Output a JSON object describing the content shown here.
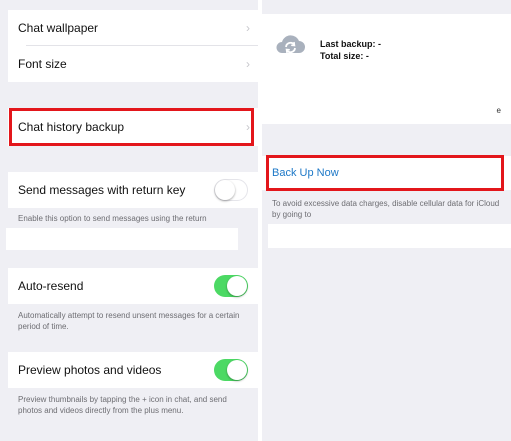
{
  "left": {
    "chat_wallpaper": "Chat wallpaper",
    "font_size": "Font size",
    "chat_history_backup": "Chat history backup",
    "send_with_return": {
      "label": "Send messages with return key",
      "desc": "Enable this option to send messages using the return",
      "enabled": false
    },
    "auto_resend": {
      "label": "Auto-resend",
      "desc": "Automatically attempt to resend unsent messages for a certain period of time.",
      "enabled": true
    },
    "preview_media": {
      "label": "Preview photos and videos",
      "desc": "Preview thumbnails by tapping the + icon in chat, and send photos and videos directly from the plus menu.",
      "enabled": true
    }
  },
  "right": {
    "last_backup": "Last backup: -",
    "total_size": "Total size: -",
    "stray_glyph": "e",
    "back_up_now": "Back Up Now",
    "desc": "To avoid excessive data charges, disable cellular data for iCloud by going to"
  },
  "colors": {
    "highlight": "#e3161b",
    "toggle_on": "#4cd964",
    "link": "#1d78c7",
    "group_bg": "#efeff4"
  },
  "icons": [
    "chevron-right-icon",
    "cloud-sync-icon"
  ]
}
